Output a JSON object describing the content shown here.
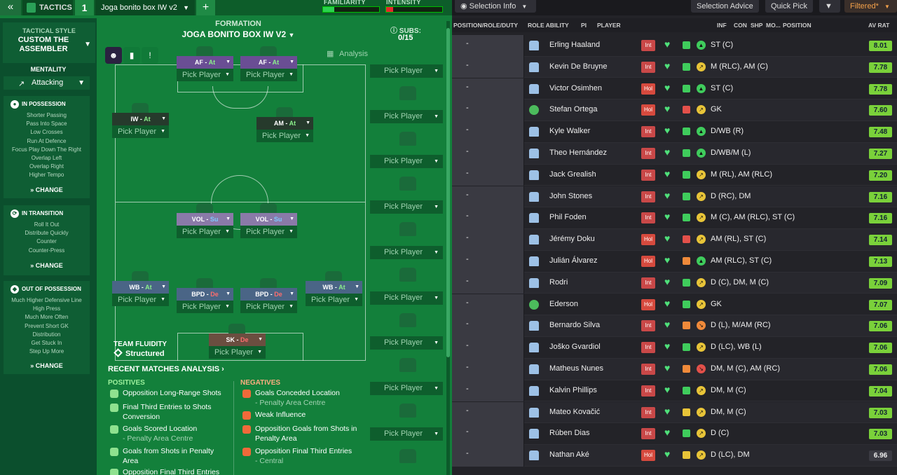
{
  "topbar": {
    "tactics_label": "TACTICS",
    "tactic_number": "1",
    "tactic_name": "Joga bonito box IW v2",
    "familiarity_label": "FAMILIARITY",
    "intensity_label": "INTENSITY",
    "familiarity_level": 0.2,
    "intensity_level": 0.12,
    "colors": {
      "familiarity": "#2bd24e",
      "intensity": "#e5282a"
    }
  },
  "tactical_style": {
    "heading": "TACTICAL STYLE",
    "name": "CUSTOM THE ASSEMBLER",
    "mentality_label": "MENTALITY",
    "mentality_value": "Attacking"
  },
  "in_possession": {
    "title": "IN POSSESSION",
    "items": [
      "Shorter Passing",
      "Pass Into Space",
      "Low Crosses",
      "Run At Defence",
      "Focus Play Down The Right",
      "Overlap Left",
      "Overlap Right",
      "Higher Tempo"
    ],
    "change": "CHANGE"
  },
  "in_transition": {
    "title": "IN TRANSITION",
    "items": [
      "Roll It Out",
      "Distribute Quickly",
      "Counter",
      "Counter-Press"
    ],
    "change": "CHANGE"
  },
  "out_of_possession": {
    "title": "OUT OF POSSESSION",
    "items": [
      "Much Higher Defensive Line",
      "High Press",
      "Much More Often",
      "Prevent Short GK",
      "Distribution",
      "Get Stuck In",
      "Step Up More"
    ],
    "change": "CHANGE"
  },
  "formation": {
    "label": "FORMATION",
    "name": "JOGA BONITO BOX IW V2",
    "subs_label": "SUBS:",
    "subs_value": "0/15",
    "analysis": "Analysis",
    "pick": "Pick Player",
    "slots": [
      {
        "pos": "AF",
        "duty": "At"
      },
      {
        "pos": "AF",
        "duty": "At"
      },
      {
        "pos": "IW",
        "duty": "At"
      },
      {
        "pos": "AM",
        "duty": "At"
      },
      {
        "pos": "VOL",
        "duty": "Su"
      },
      {
        "pos": "VOL",
        "duty": "Su"
      },
      {
        "pos": "WB",
        "duty": "At"
      },
      {
        "pos": "BPD",
        "duty": "De"
      },
      {
        "pos": "BPD",
        "duty": "De"
      },
      {
        "pos": "WB",
        "duty": "At"
      },
      {
        "pos": "SK",
        "duty": "De"
      }
    ],
    "fluidity_label": "TEAM FLUIDITY",
    "fluidity_value": "Structured"
  },
  "analysis": {
    "title": "RECENT MATCHES ANALYSIS",
    "positives_label": "POSITIVES",
    "negatives_label": "NEGATIVES",
    "positives": [
      {
        "text": "Opposition Long-Range Shots",
        "sub": ""
      },
      {
        "text": "Final Third Entries to Shots Conversion",
        "sub": ""
      },
      {
        "text": "Goals Scored Location",
        "sub": "- Penalty Area Centre"
      },
      {
        "text": "Goals from Shots in Penalty Area",
        "sub": ""
      },
      {
        "text": "Opposition Final Third Entries",
        "sub": ""
      }
    ],
    "negatives": [
      {
        "text": "Goals Conceded Location",
        "sub": "- Penalty Area Centre"
      },
      {
        "text": "Weak Influence",
        "sub": ""
      },
      {
        "text": "Opposition Goals from Shots in Penalty Area",
        "sub": ""
      },
      {
        "text": "Opposition Final Third Entries",
        "sub": "- Central"
      }
    ]
  },
  "right_toolbar": {
    "selection_info": "Selection Info",
    "selection_advice": "Selection Advice",
    "quick_pick": "Quick Pick",
    "filtered": "Filtered*"
  },
  "table": {
    "headers": {
      "position": "POSITION/ROLE/DUTY",
      "role_ability": "ROLE ABILITY",
      "pi": "PI",
      "player": "PLAYER",
      "inf": "INF",
      "con": "CON",
      "shp": "SHP",
      "mo": "MO...",
      "position2": "POSITION",
      "avrat": "AV RAT"
    },
    "placeholder": "-",
    "rows": [
      {
        "name": "Erling Haaland",
        "inf": "Int",
        "shp": "g",
        "mo": "g",
        "moglyph": "▲",
        "pos": "ST (C)",
        "rat": "8.01",
        "gk": false
      },
      {
        "name": "Kevin De Bruyne",
        "inf": "Int",
        "shp": "g",
        "mo": "y",
        "moglyph": "↗",
        "pos": "M (RLC), AM (C)",
        "rat": "7.78",
        "gk": false
      },
      {
        "name": "Victor Osimhen",
        "inf": "Hol",
        "shp": "g",
        "mo": "g",
        "moglyph": "▲",
        "pos": "ST (C)",
        "rat": "7.78",
        "gk": false
      },
      {
        "name": "Stefan Ortega",
        "inf": "Hol",
        "shp": "r",
        "mo": "y",
        "moglyph": "↗",
        "pos": "GK",
        "rat": "7.60",
        "gk": true
      },
      {
        "name": "Kyle Walker",
        "inf": "Int",
        "shp": "g",
        "mo": "g",
        "moglyph": "▲",
        "pos": "D/WB (R)",
        "rat": "7.48",
        "gk": false
      },
      {
        "name": "Theo Hernández",
        "inf": "Int",
        "shp": "g",
        "mo": "g",
        "moglyph": "▲",
        "pos": "D/WB/M (L)",
        "rat": "7.27",
        "gk": false
      },
      {
        "name": "Jack Grealish",
        "inf": "Int",
        "shp": "g",
        "mo": "y",
        "moglyph": "↗",
        "pos": "M (RL), AM (RLC)",
        "rat": "7.20",
        "gk": false
      },
      {
        "name": "John Stones",
        "inf": "Int",
        "shp": "g",
        "mo": "y",
        "moglyph": "↗",
        "pos": "D (RC), DM",
        "rat": "7.16",
        "gk": false
      },
      {
        "name": "Phil Foden",
        "inf": "Int",
        "shp": "g",
        "mo": "y",
        "moglyph": "↗",
        "pos": "M (C), AM (RLC), ST (C)",
        "rat": "7.16",
        "gk": false
      },
      {
        "name": "Jérémy Doku",
        "inf": "Hol",
        "shp": "r",
        "mo": "y",
        "moglyph": "↗",
        "pos": "AM (RL), ST (C)",
        "rat": "7.14",
        "gk": false
      },
      {
        "name": "Julián Álvarez",
        "inf": "Hol",
        "shp": "o",
        "mo": "g",
        "moglyph": "▲",
        "pos": "AM (RLC), ST (C)",
        "rat": "7.13",
        "gk": false
      },
      {
        "name": "Rodri",
        "inf": "Int",
        "shp": "g",
        "mo": "y",
        "moglyph": "↗",
        "pos": "D (C), DM, M (C)",
        "rat": "7.09",
        "gk": false
      },
      {
        "name": "Ederson",
        "inf": "Hol",
        "shp": "g",
        "mo": "y",
        "moglyph": "↗",
        "pos": "GK",
        "rat": "7.07",
        "gk": true
      },
      {
        "name": "Bernardo Silva",
        "inf": "Int",
        "shp": "o",
        "mo": "o",
        "moglyph": "↘",
        "pos": "D (L), M/AM (RC)",
        "rat": "7.06",
        "gk": false
      },
      {
        "name": "Joško Gvardiol",
        "inf": "Int",
        "shp": "g",
        "mo": "y",
        "moglyph": "↗",
        "pos": "D (LC), WB (L)",
        "rat": "7.06",
        "gk": false
      },
      {
        "name": "Matheus Nunes",
        "inf": "Int",
        "shp": "o",
        "mo": "r",
        "moglyph": "↘",
        "pos": "DM, M (C), AM (RC)",
        "rat": "7.06",
        "gk": false
      },
      {
        "name": "Kalvin Phillips",
        "inf": "Int",
        "shp": "g",
        "mo": "y",
        "moglyph": "↗",
        "pos": "DM, M (C)",
        "rat": "7.04",
        "gk": false
      },
      {
        "name": "Mateo Kovačić",
        "inf": "Int",
        "shp": "y",
        "mo": "y",
        "moglyph": "↗",
        "pos": "DM, M (C)",
        "rat": "7.03",
        "gk": false
      },
      {
        "name": "Rúben Dias",
        "inf": "Int",
        "shp": "g",
        "mo": "y",
        "moglyph": "↗",
        "pos": "D (C)",
        "rat": "7.03",
        "gk": false
      },
      {
        "name": "Nathan Aké",
        "inf": "Hol",
        "shp": "y",
        "mo": "y",
        "moglyph": "↗",
        "pos": "D (LC), DM",
        "rat": "6.96",
        "gk": false
      }
    ]
  }
}
